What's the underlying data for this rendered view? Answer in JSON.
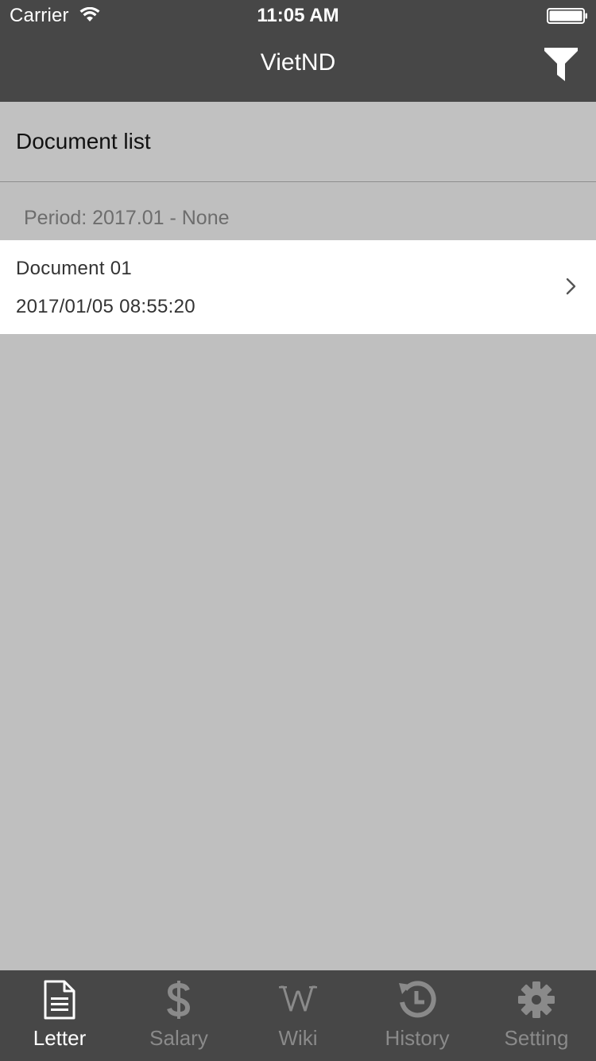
{
  "status_bar": {
    "carrier": "Carrier",
    "time": "11:05 AM"
  },
  "nav": {
    "title": "VietND",
    "filter_icon": "filter-icon"
  },
  "section": {
    "title": "Document list"
  },
  "period": {
    "text": "Period: 2017.01 - None"
  },
  "documents": [
    {
      "title": "Document 01",
      "date": "2017/01/05 08:55:20"
    }
  ],
  "tabs": [
    {
      "label": "Letter",
      "icon": "document-icon",
      "active": true
    },
    {
      "label": "Salary",
      "icon": "dollar-icon",
      "active": false
    },
    {
      "label": "Wiki",
      "icon": "wiki-icon",
      "active": false
    },
    {
      "label": "History",
      "icon": "history-icon",
      "active": false
    },
    {
      "label": "Setting",
      "icon": "gear-icon",
      "active": false
    }
  ],
  "colors": {
    "bar_background": "#474747",
    "content_background": "#bfbfbf",
    "active_tab": "#ffffff",
    "inactive_tab": "#8a8a8a"
  }
}
